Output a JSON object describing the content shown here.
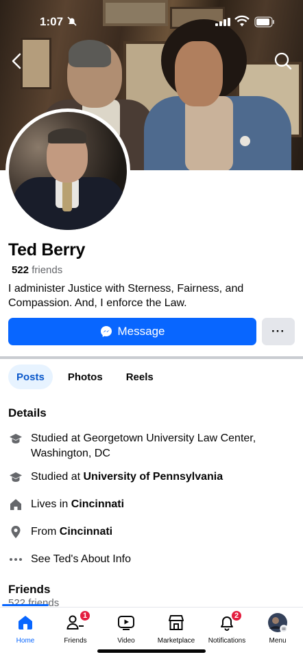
{
  "status": {
    "time": "1:07"
  },
  "profile": {
    "name": "Ted Berry",
    "friends_count": "522",
    "friends_word": "friends",
    "bio": "I administer Justice with Sterness, Fairness, and Compassion. And, I enforce the Law."
  },
  "actions": {
    "message_label": "Message",
    "more_label": "···"
  },
  "tabs": [
    {
      "label": "Posts",
      "active": true
    },
    {
      "label": "Photos",
      "active": false
    },
    {
      "label": "Reels",
      "active": false
    }
  ],
  "details": {
    "title": "Details",
    "items": [
      {
        "icon": "graduation-cap-icon",
        "pre": "Studied at Georgetown University Law Center, Washington, DC",
        "bold": ""
      },
      {
        "icon": "graduation-cap-icon",
        "pre": "Studied at ",
        "bold": "University of Pennsylvania"
      },
      {
        "icon": "house-icon",
        "pre": "Lives in ",
        "bold": "Cincinnati"
      },
      {
        "icon": "location-pin-icon",
        "pre": "From ",
        "bold": "Cincinnati"
      },
      {
        "icon": "more-dots-icon",
        "pre": "See Ted's About Info",
        "bold": ""
      }
    ]
  },
  "friends_section": {
    "title": "Friends",
    "subtitle": "522 friends"
  },
  "bottom_nav": [
    {
      "label": "Home",
      "icon": "home-icon",
      "badge": "",
      "active": true
    },
    {
      "label": "Friends",
      "icon": "friends-icon",
      "badge": "1",
      "active": false
    },
    {
      "label": "Video",
      "icon": "video-icon",
      "badge": "",
      "active": false
    },
    {
      "label": "Marketplace",
      "icon": "marketplace-icon",
      "badge": "",
      "active": false
    },
    {
      "label": "Notifications",
      "icon": "bell-icon",
      "badge": "2",
      "active": false
    },
    {
      "label": "Menu",
      "icon": "menu-avatar-icon",
      "badge": "",
      "active": false
    }
  ],
  "colors": {
    "accent": "#0866ff",
    "badge": "#e41e3f",
    "tab_active_bg": "#e7f3ff"
  }
}
